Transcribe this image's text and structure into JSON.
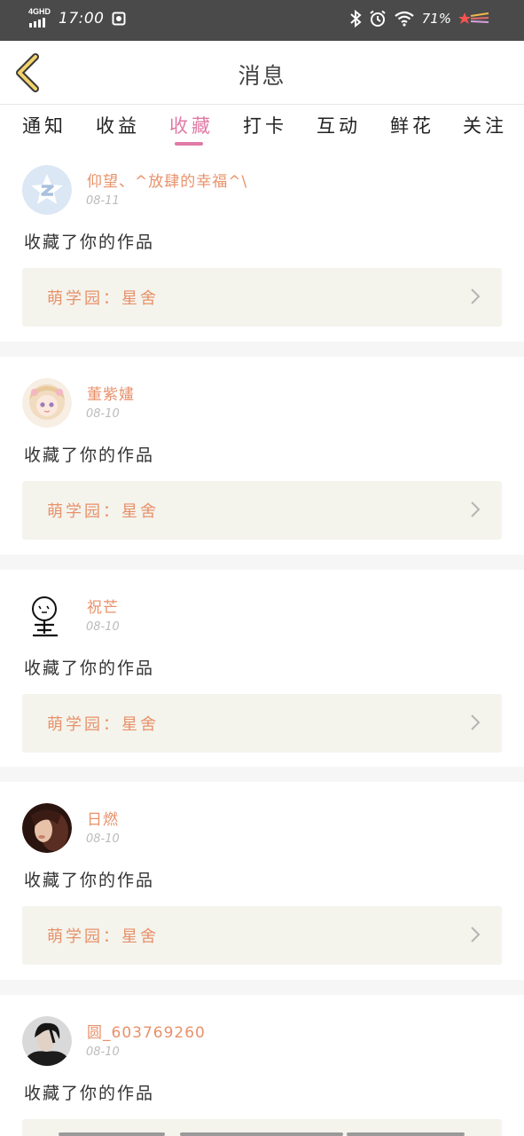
{
  "status_bar": {
    "network": "4GHD",
    "time": "17:00",
    "battery": "71%",
    "icons": [
      "signal-icon",
      "screenshot-icon",
      "bluetooth-icon",
      "alarm-icon",
      "wifi-icon",
      "shooting-star-icon"
    ]
  },
  "header": {
    "title": "消息",
    "back_icon": "chevron-left-icon"
  },
  "tabs": [
    {
      "label": "通知"
    },
    {
      "label": "收益"
    },
    {
      "label": "收藏",
      "active": true
    },
    {
      "label": "打卡"
    },
    {
      "label": "互动"
    },
    {
      "label": "鲜花"
    },
    {
      "label": "关注"
    }
  ],
  "messages": [
    {
      "user": "仰望、^放肆的幸福^\\",
      "date": "08-11",
      "action": "收藏了你的作品",
      "work": "萌学园：星舍",
      "avatar": "qq-default-avatar"
    },
    {
      "user": "董紫嫿",
      "date": "08-10",
      "action": "收藏了你的作品",
      "work": "萌学园：星舍",
      "avatar": "anime-girl-avatar"
    },
    {
      "user": "祝芒",
      "date": "08-10",
      "action": "收藏了你的作品",
      "work": "萌学园：星舍",
      "avatar": "doodle-avatar"
    },
    {
      "user": "日燃",
      "date": "08-10",
      "action": "收藏了你的作品",
      "work": "萌学园：星舍",
      "avatar": "photo-avatar"
    },
    {
      "user": "圆_603769260",
      "date": "08-10",
      "action": "收藏了你的作品",
      "work": "",
      "avatar": "dark-portrait-avatar"
    }
  ],
  "colors": {
    "accent_pink": "#e07aa6",
    "name_orange": "#e8916a",
    "status_bar": "#4a4a4a",
    "back_arrow": "#f3d36b"
  }
}
